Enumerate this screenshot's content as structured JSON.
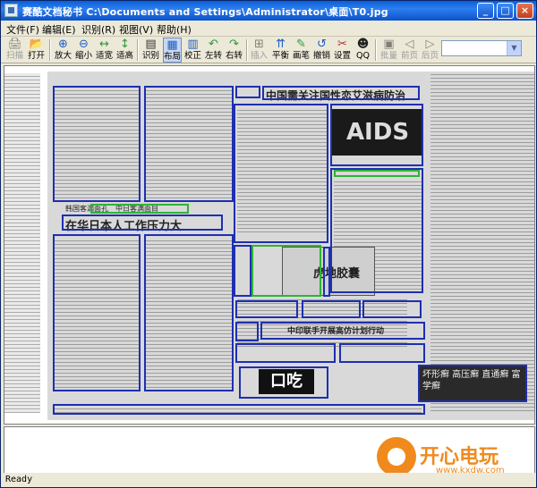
{
  "window": {
    "title": "赛酷文档秘书 C:\\Documents and Settings\\Administrator\\桌面\\T0.jpg",
    "minimize": "_",
    "maximize": "□",
    "close": "×"
  },
  "menu": [
    "文件(F)",
    "编辑(E)",
    "识别(R)",
    "视图(V)",
    "帮助(H)"
  ],
  "toolbar": [
    {
      "label": "扫描",
      "icon": "scan-icon",
      "disabled": true
    },
    {
      "label": "打开",
      "icon": "open-icon",
      "disabled": false
    },
    {
      "label": "放大",
      "icon": "zoom-in-icon",
      "disabled": false
    },
    {
      "label": "缩小",
      "icon": "zoom-out-icon",
      "disabled": false
    },
    {
      "label": "适宽",
      "icon": "fit-width-icon",
      "disabled": false
    },
    {
      "label": "适高",
      "icon": "fit-height-icon",
      "disabled": false
    },
    {
      "label": "识别",
      "icon": "recognize-icon",
      "disabled": false
    },
    {
      "label": "布局",
      "icon": "layout-icon",
      "disabled": false
    },
    {
      "label": "校正",
      "icon": "correct-icon",
      "disabled": false
    },
    {
      "label": "左转",
      "icon": "rotate-left-icon",
      "disabled": false
    },
    {
      "label": "右转",
      "icon": "rotate-right-icon",
      "disabled": false
    },
    {
      "label": "插入",
      "icon": "insert-icon",
      "disabled": true
    },
    {
      "label": "平衡",
      "icon": "balance-icon",
      "disabled": false
    },
    {
      "label": "画笔",
      "icon": "brush-icon",
      "disabled": false
    },
    {
      "label": "撤销",
      "icon": "undo-icon",
      "disabled": false
    },
    {
      "label": "设置",
      "icon": "settings-icon",
      "disabled": false
    },
    {
      "label": "QQ",
      "icon": "qq-icon",
      "disabled": false
    },
    {
      "label": "批量",
      "icon": "batch-icon",
      "disabled": true
    },
    {
      "label": "前页",
      "icon": "prev-page-icon",
      "disabled": true
    },
    {
      "label": "后页",
      "icon": "next-page-icon",
      "disabled": true
    }
  ],
  "document": {
    "headline_1": "中国需关注国性恋艾滋病防治",
    "headline_2": "在华日本人工作压力大",
    "headline_3": "虎地胶囊",
    "headline_4": "中印联手开展高仿计划行动",
    "caption_1": "韩国客满面孔　中日客满面目",
    "aids_text": "AIDS",
    "ad_big": "口吃",
    "ad_right": "坏形癣 高压癣 直通癣 富学癣"
  },
  "status": "Ready",
  "watermark": {
    "brand": "开心电玩",
    "url": "www.kxdw.com"
  }
}
